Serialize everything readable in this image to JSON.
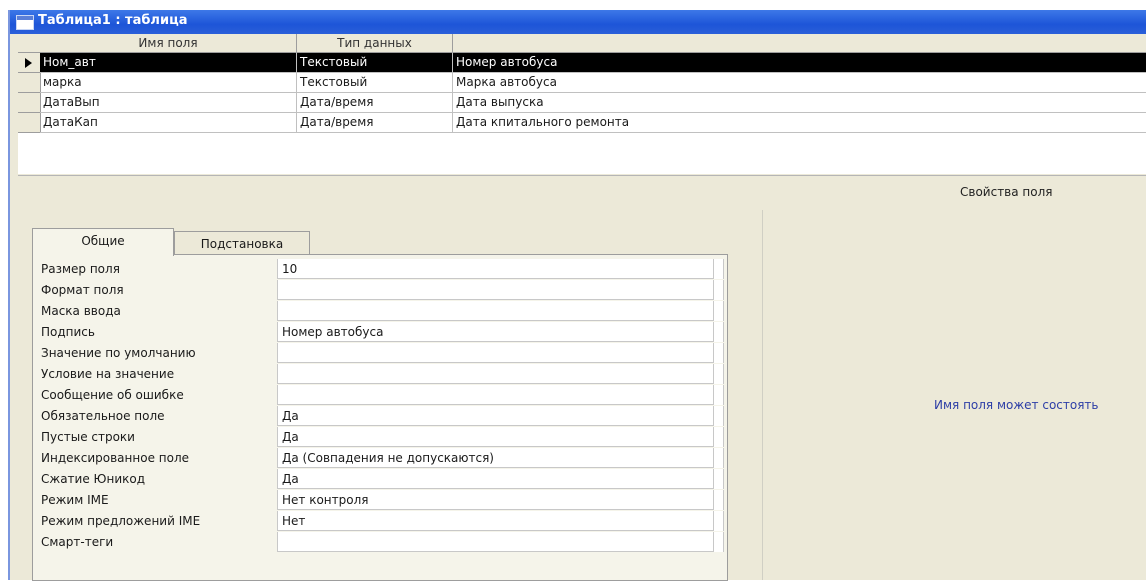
{
  "window": {
    "title": "Таблица1 : таблица"
  },
  "grid": {
    "columns": [
      "Имя поля",
      "Тип данных",
      ""
    ],
    "rows": [
      {
        "name": "Ном_авт",
        "type": "Текстовый",
        "desc": "Номер автобуса",
        "selected": true
      },
      {
        "name": "марка",
        "type": "Текстовый",
        "desc": "Марка автобуса",
        "selected": false
      },
      {
        "name": "ДатаВып",
        "type": "Дата/время",
        "desc": "Дата выпуска",
        "selected": false
      },
      {
        "name": "ДатаКап",
        "type": "Дата/время",
        "desc": "Дата кпитального ремонта",
        "selected": false
      }
    ]
  },
  "section_label": "Свойства поля",
  "tabs": {
    "general": "Общие",
    "lookup": "Подстановка"
  },
  "properties": [
    {
      "label": "Размер поля",
      "value": "10"
    },
    {
      "label": "Формат поля",
      "value": ""
    },
    {
      "label": "Маска ввода",
      "value": ""
    },
    {
      "label": "Подпись",
      "value": "Номер автобуса"
    },
    {
      "label": "Значение по умолчанию",
      "value": ""
    },
    {
      "label": "Условие на значение",
      "value": ""
    },
    {
      "label": "Сообщение об ошибке",
      "value": ""
    },
    {
      "label": "Обязательное поле",
      "value": "Да"
    },
    {
      "label": "Пустые строки",
      "value": "Да"
    },
    {
      "label": "Индексированное поле",
      "value": "Да (Совпадения не допускаются)"
    },
    {
      "label": "Сжатие Юникод",
      "value": "Да"
    },
    {
      "label": "Режим IME",
      "value": "Нет контроля"
    },
    {
      "label": "Режим предложений IME",
      "value": "Нет"
    },
    {
      "label": "Смарт-теги",
      "value": ""
    }
  ],
  "help_text": "Имя поля может состоять"
}
